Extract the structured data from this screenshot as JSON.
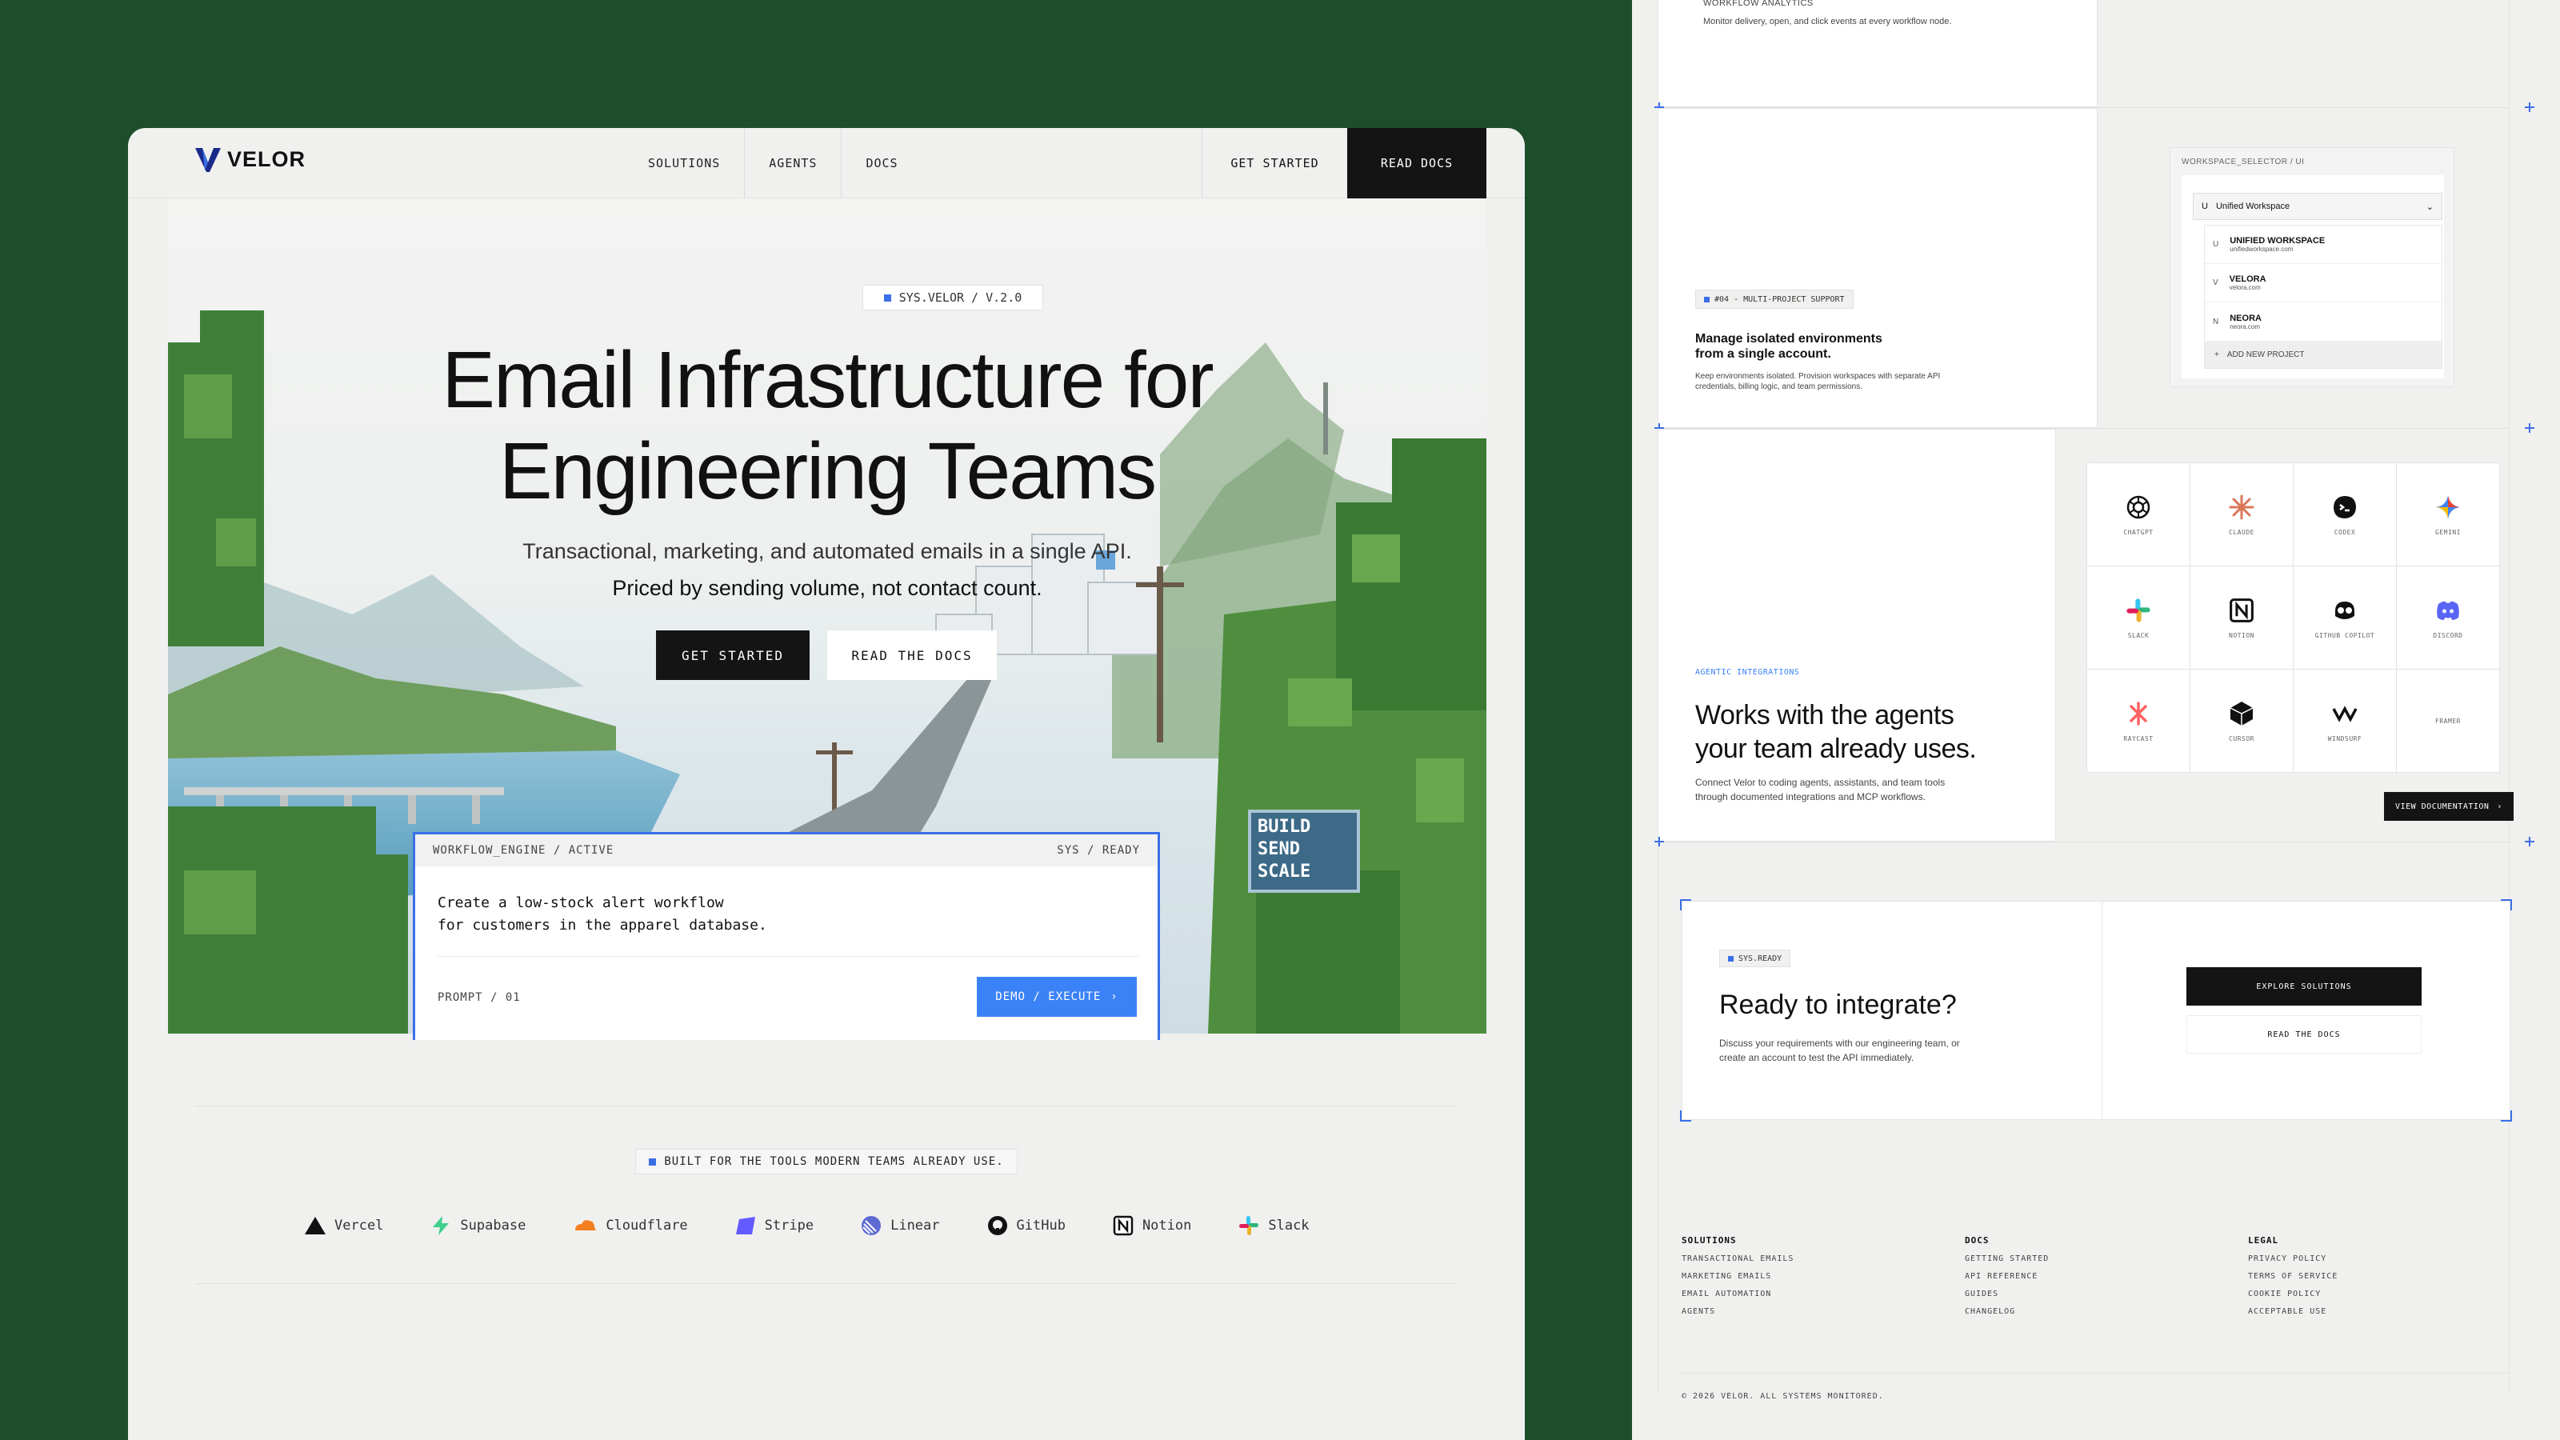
{
  "nav": {
    "logo": "VELOR",
    "links": [
      "SOLUTIONS",
      "AGENTS",
      "DOCS"
    ],
    "get_started": "GET STARTED",
    "read_docs": "READ DOCS"
  },
  "hero": {
    "chip": "SYS.VELOR / V.2.0",
    "title_line1": "Email Infrastructure for",
    "title_line2": "Engineering Teams",
    "subtitle1": "Transactional, marketing, and automated emails in a single API.",
    "subtitle2": "Priced by sending volume, not contact count.",
    "cta_primary": "GET STARTED",
    "cta_secondary": "READ THE DOCS",
    "sign_lines": [
      "BUILD",
      "SEND",
      "SCALE"
    ],
    "building_badge": "S"
  },
  "workflow": {
    "left_label": "WORKFLOW_ENGINE / ACTIVE",
    "right_label": "SYS / READY",
    "prompt_line1": "Create a low-stock alert workflow",
    "prompt_line2": "for customers in the apparel database.",
    "prompt_counter": "PROMPT / 01",
    "execute_label": "DEMO / EXECUTE"
  },
  "tools": {
    "chip": "BUILT FOR THE TOOLS MODERN TEAMS ALREADY USE.",
    "items": [
      {
        "name": "Vercel",
        "icon": "vercel-icon",
        "color": "#111111"
      },
      {
        "name": "Supabase",
        "icon": "supabase-icon",
        "color": "#3ecf8e"
      },
      {
        "name": "Cloudflare",
        "icon": "cloudflare-icon",
        "color": "#f38020"
      },
      {
        "name": "Stripe",
        "icon": "stripe-icon",
        "color": "#635bff"
      },
      {
        "name": "Linear",
        "icon": "linear-icon",
        "color": "#5e6ad2"
      },
      {
        "name": "GitHub",
        "icon": "github-icon",
        "color": "#111111"
      },
      {
        "name": "Notion",
        "icon": "notion-icon",
        "color": "#111111"
      },
      {
        "name": "Slack",
        "icon": "slack-icon",
        "color": "#e01e5a"
      }
    ]
  },
  "analytics": {
    "label": "WORKFLOW ANALYTICS",
    "desc": "Monitor delivery, open, and click events at every workflow node."
  },
  "multiproject": {
    "chip": "#04 - MULTI-PROJECT SUPPORT",
    "title_line1": "Manage isolated environments",
    "title_line2": "from a single account.",
    "desc_line1": "Keep environments isolated. Provision workspaces with separate API",
    "desc_line2": "credentials, billing logic, and team permissions.",
    "selector_label": "WORKSPACE_SELECTOR / UI",
    "selected": "Unified Workspace",
    "selected_initial": "U",
    "options": [
      {
        "initial": "U",
        "name": "UNIFIED WORKSPACE",
        "domain": "unifiedworkspace.com"
      },
      {
        "initial": "V",
        "name": "VELORA",
        "domain": "velora.com"
      },
      {
        "initial": "N",
        "name": "NEORA",
        "domain": "neora.com"
      }
    ],
    "add_label": "ADD NEW PROJECT"
  },
  "agents": {
    "label": "AGENTIC INTEGRATIONS",
    "title_line1": "Works with the agents",
    "title_line2": "your team already uses.",
    "desc_line1": "Connect Velor to coding agents, assistants, and team tools",
    "desc_line2": "through documented integrations and MCP workflows.",
    "items": [
      {
        "name": "CHATGPT",
        "icon": "chatgpt-icon",
        "color": "#111111"
      },
      {
        "name": "CLAUDE",
        "icon": "claude-icon",
        "color": "#d97757"
      },
      {
        "name": "CODEX",
        "icon": "codex-icon",
        "color": "#111111"
      },
      {
        "name": "GEMINI",
        "icon": "gemini-icon",
        "color": "#4285f4"
      },
      {
        "name": "SLACK",
        "icon": "slack-icon",
        "color": "#e01e5a"
      },
      {
        "name": "NOTION",
        "icon": "notion-icon",
        "color": "#111111"
      },
      {
        "name": "GITHUB COPILOT",
        "icon": "copilot-icon",
        "color": "#111111"
      },
      {
        "name": "DISCORD",
        "icon": "discord-icon",
        "color": "#5865f2"
      },
      {
        "name": "RAYCAST",
        "icon": "raycast-icon",
        "color": "#ff6363"
      },
      {
        "name": "CURSOR",
        "icon": "cursor-icon",
        "color": "#111111"
      },
      {
        "name": "WINDSURF",
        "icon": "windsurf-icon",
        "color": "#111111"
      },
      {
        "name": "FRAMER",
        "icon": "",
        "color": "#111111"
      }
    ],
    "doc_button": "VIEW DOCUMENTATION"
  },
  "integrate": {
    "chip": "SYS.READY",
    "title": "Ready to integrate?",
    "desc_line1": "Discuss your requirements with our engineering team, or",
    "desc_line2": "create an account to test the API immediately.",
    "primary": "EXPLORE SOLUTIONS",
    "secondary": "READ THE DOCS"
  },
  "footer": {
    "columns": [
      {
        "heading": "SOLUTIONS",
        "links": [
          "TRANSACTIONAL EMAILS",
          "MARKETING EMAILS",
          "EMAIL AUTOMATION",
          "AGENTS"
        ]
      },
      {
        "heading": "DOCS",
        "links": [
          "GETTING STARTED",
          "API REFERENCE",
          "GUIDES",
          "CHANGELOG"
        ]
      },
      {
        "heading": "LEGAL",
        "links": [
          "PRIVACY POLICY",
          "TERMS OF SERVICE",
          "COOKIE POLICY",
          "ACCEPTABLE USE"
        ]
      }
    ],
    "copyright": "© 2026 VELOR. ALL SYSTEMS MONITORED."
  },
  "colors": {
    "accent": "#3b6fe8",
    "dark": "#141414",
    "background": "#1d4d29"
  }
}
